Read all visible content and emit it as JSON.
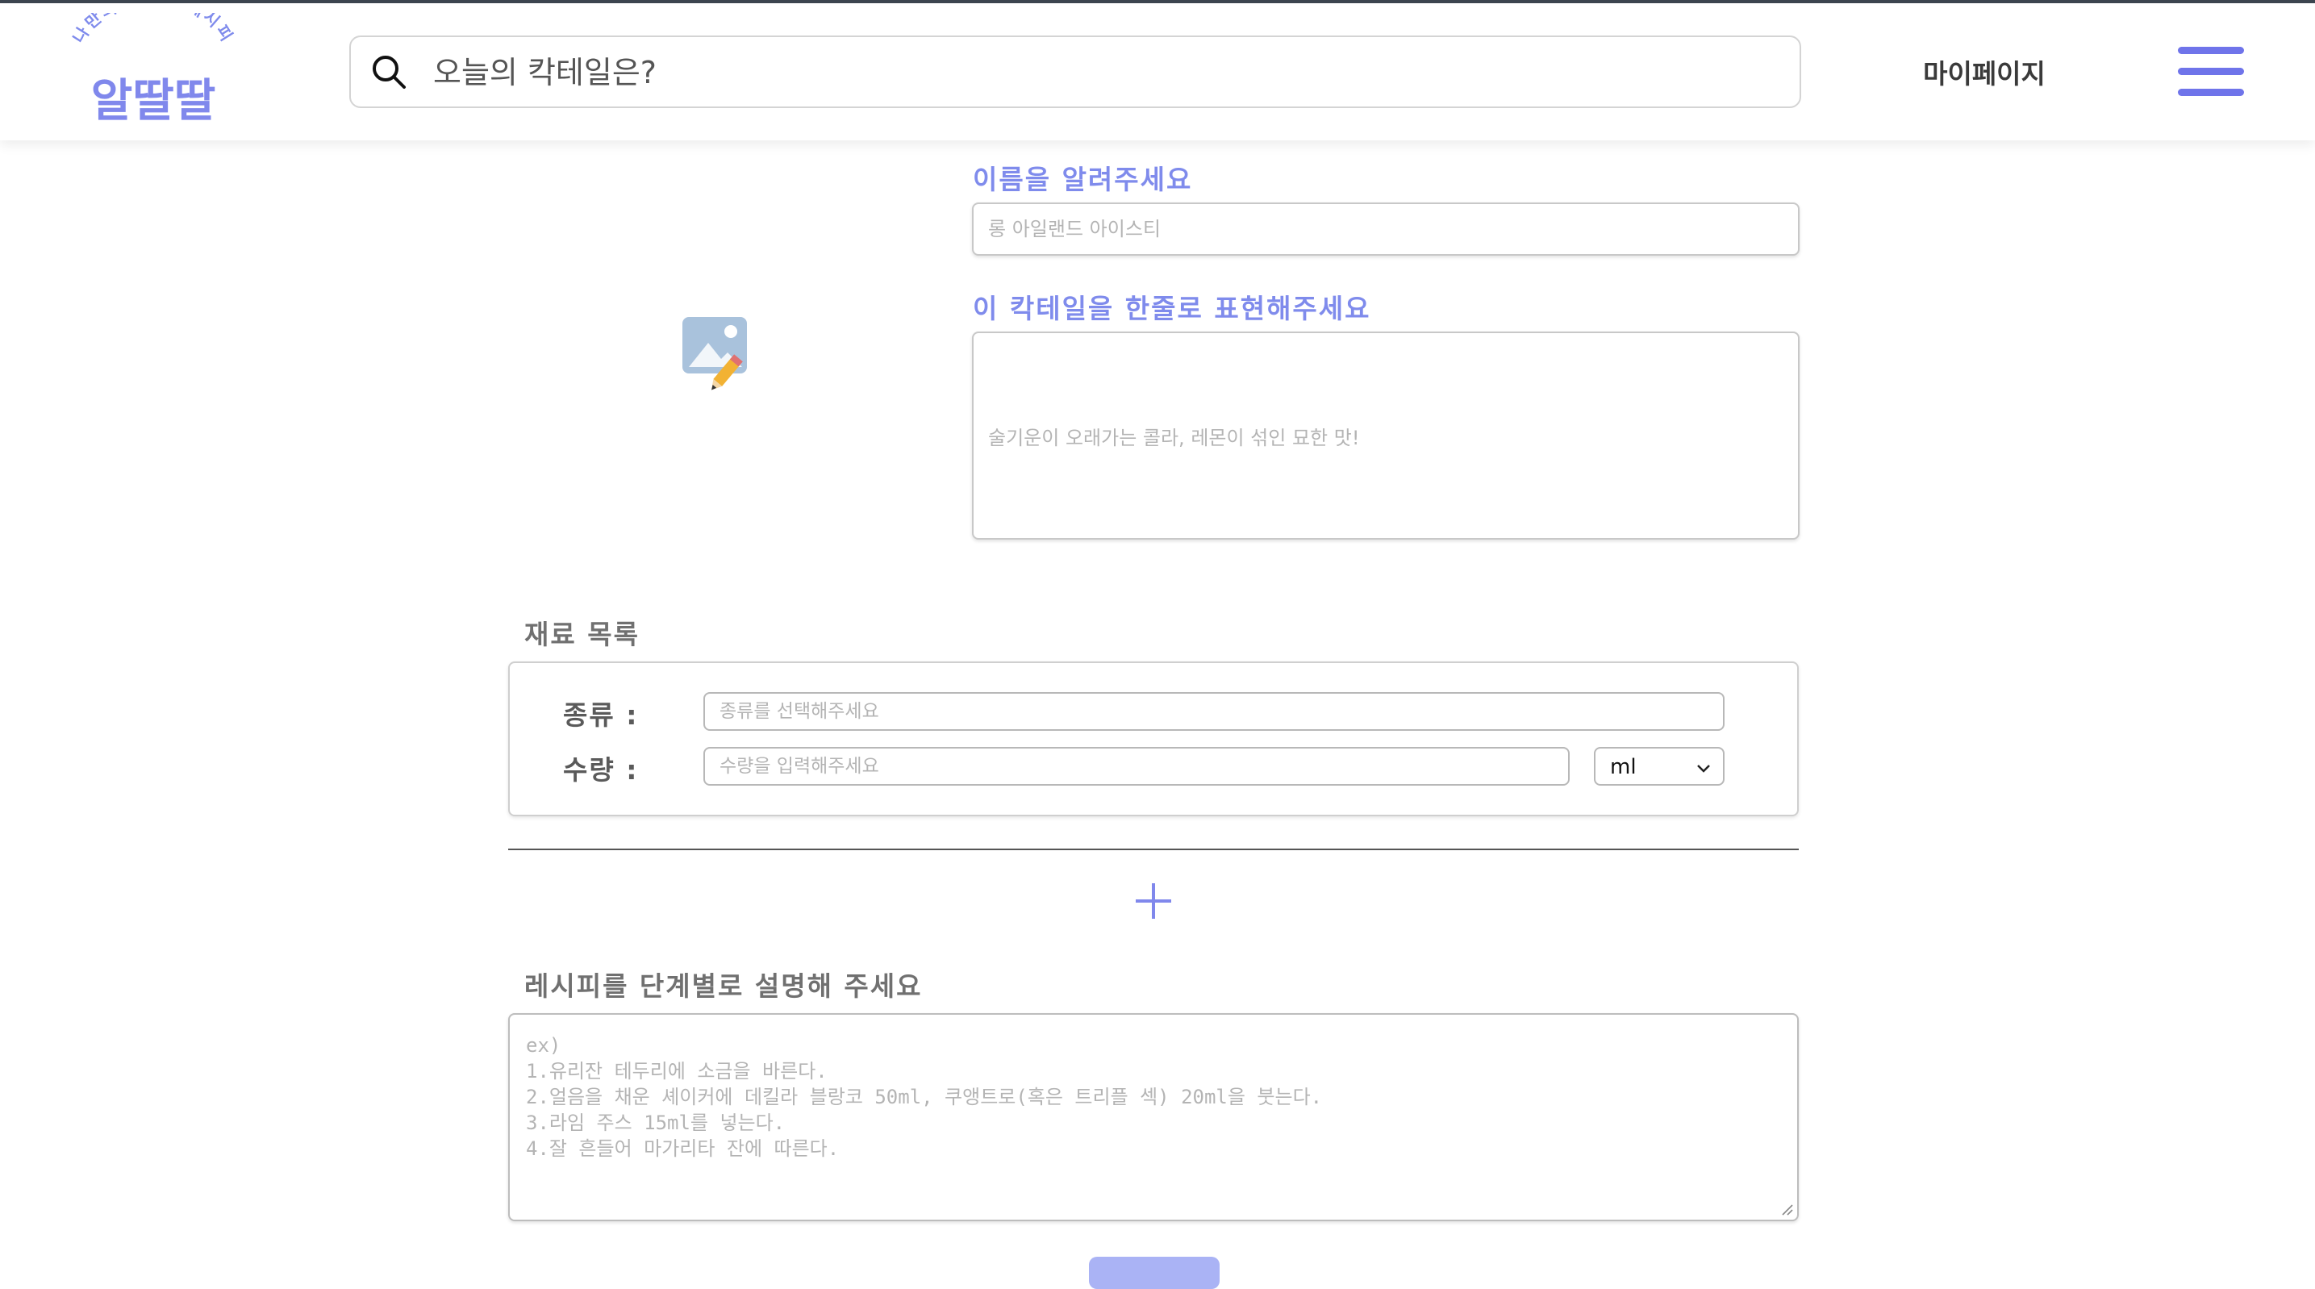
{
  "header": {
    "logo": {
      "tagline": "나만의 칵테일 레시피",
      "name": "알딸딸"
    },
    "search": {
      "placeholder": "오늘의 칵테일은?",
      "icon": "search-icon"
    },
    "mypage_label": "마이페이지",
    "menu_icon": "hamburger-menu-icon",
    "accent_color": "#6f74ea"
  },
  "form": {
    "image_upload_icon": "image-edit-icon",
    "name": {
      "label": "이름을 알려주세요",
      "placeholder": "롱 아일랜드 아이스티"
    },
    "description": {
      "label": "이 칵테일을 한줄로 표현해주세요",
      "placeholder": "술기운이 오래가는 콜라, 레몬이 섞인 묘한 맛!"
    },
    "ingredients": {
      "section_title": "재료 목록",
      "type_label": "종류 :",
      "type_placeholder": "종류를 선택해주세요",
      "amount_label": "수량 :",
      "amount_placeholder": "수량을 입력해주세요",
      "unit_selected": "ml"
    },
    "add_icon": "plus-icon",
    "recipe": {
      "section_title": "레시피를 단계별로 설명해 주세요",
      "placeholder_lines": [
        "ex)",
        "1.유리잔 테두리에 소금을 바른다.",
        "2.얼음을 채운 셰이커에 데킬라 블랑코 50ml, 쿠앵트로(혹은 트리플 섹) 20ml을 붓는다.",
        "3.라임 주스 15ml를 넣는다.",
        "4.잘 흔들어 마가리타 잔에 따른다."
      ]
    }
  }
}
